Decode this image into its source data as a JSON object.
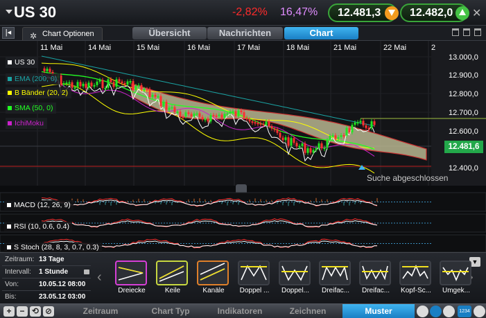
{
  "header": {
    "symbol": "US 30",
    "change_pct": "-2,82%",
    "range_pct": "16,47%",
    "sell_price": "12.481,3",
    "buy_price": "12.482,0",
    "close_label": "✕"
  },
  "tabs": {
    "collapse_label": "|◂",
    "chart_options": "Chart Optionen",
    "items": [
      "Übersicht",
      "Nachrichten",
      "Chart"
    ],
    "active": "Chart"
  },
  "chart": {
    "date_labels": [
      "11 Mai",
      "14 Mai",
      "15 Mai",
      "16 Mai",
      "17 Mai",
      "18 Mai",
      "21 Mai",
      "22 Mai",
      "2"
    ],
    "price_labels": [
      "13.000,0",
      "12.900,0",
      "12.800,0",
      "12.700,0",
      "12.600,0",
      "12.400,0"
    ],
    "last_price": "12.481,6",
    "search_status": "Suche abgeschlossen",
    "legend": [
      {
        "label": "US 30",
        "color": "#ffffff"
      },
      {
        "label": "EMA (200, 0)",
        "color": "#1aa3a3"
      },
      {
        "label": "B Bänder (20, 2)",
        "color": "#ffff00"
      },
      {
        "label": "SMA (50, 0)",
        "color": "#22ff22"
      },
      {
        "label": "IchiMoku",
        "color": "#cc22cc"
      }
    ],
    "indicators": [
      "MACD (12, 26, 9)",
      "RSI (10, 0.6, 0.4)",
      "S Stoch (28, 8, 3, 0.7, 0.3)"
    ],
    "colors": {
      "up": "#22e622",
      "down": "#ff3030",
      "cloud": "#b9b58f",
      "cloud_edge": "#2ad12a"
    }
  },
  "info": [
    {
      "key": "Zeitraum:",
      "value": "13 Tage"
    },
    {
      "key": "Intervall:",
      "value": "1 Stunde"
    },
    {
      "key": "Von:",
      "value": "10.05.12 08:00"
    },
    {
      "key": "Bis:",
      "value": "23.05.12 03:00"
    }
  ],
  "patterns": [
    "Dreiecke",
    "Keile",
    "Kanäle",
    "Doppel ...",
    "Doppel...",
    "Dreifac...",
    "Dreifac...",
    "Kopf-Sc...",
    "Umgek..."
  ],
  "footer": {
    "tabs": [
      "Zeitraum",
      "Chart Typ",
      "Indikatoren",
      "Zeichnen",
      "Muster"
    ],
    "active": "Muster",
    "zoom_in": "+",
    "zoom_out": "−",
    "badge": "1234"
  }
}
